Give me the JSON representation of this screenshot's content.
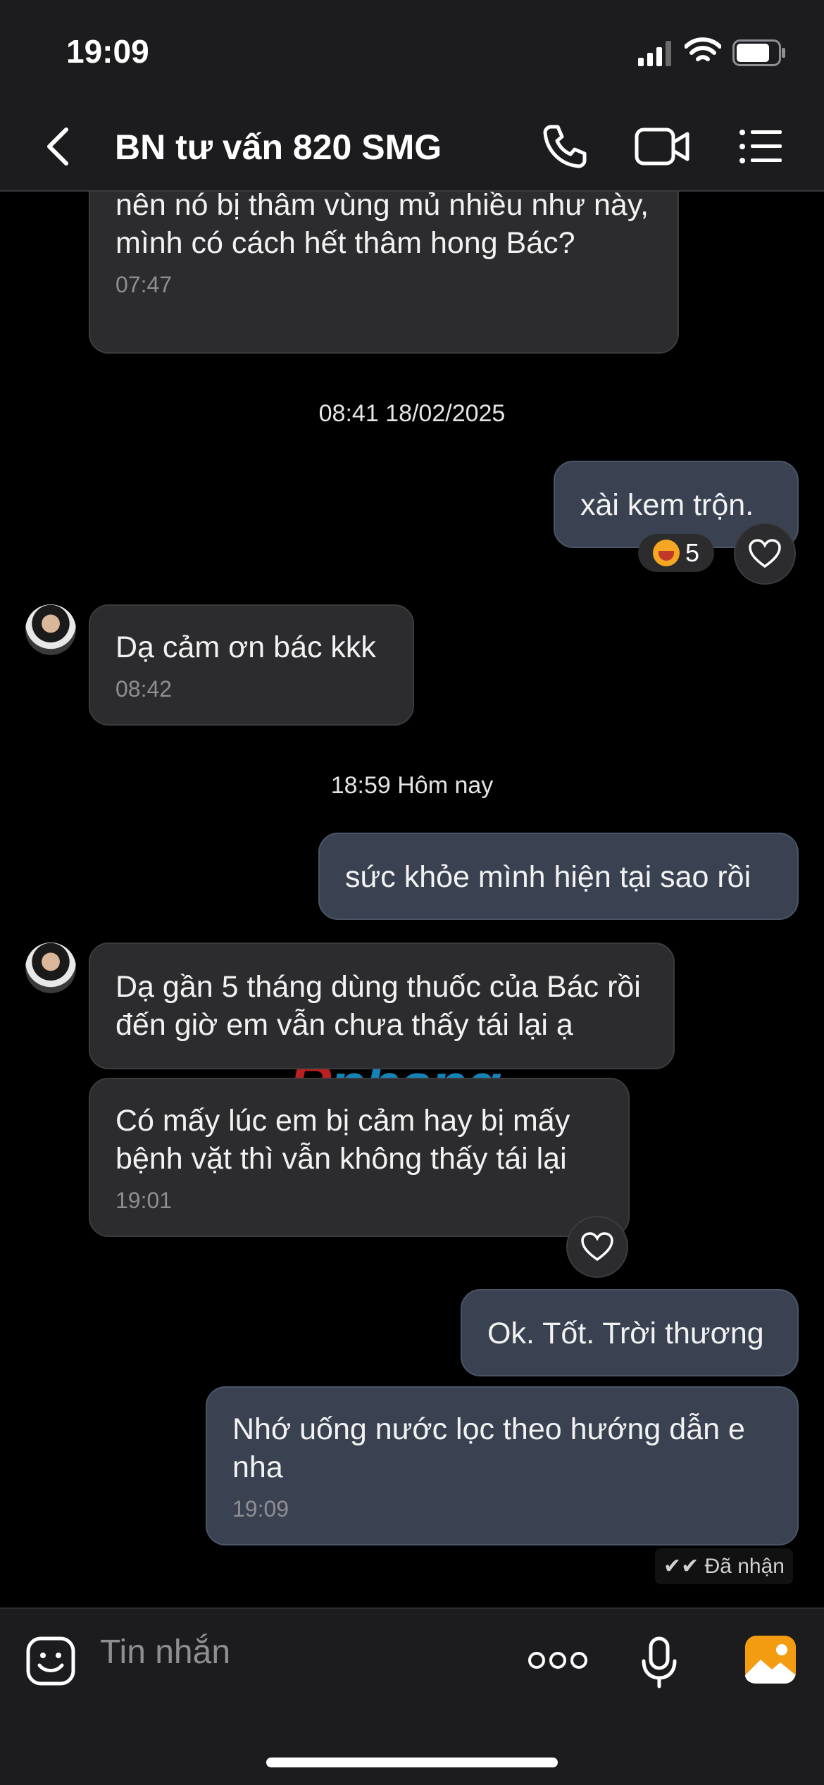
{
  "status_bar": {
    "time": "19:09"
  },
  "header": {
    "title": "BN tư vấn 820 SMG"
  },
  "messages": [
    {
      "text": "nên nó bị thâm vùng mủ nhiều như này, mình có cách hết thâm hong Bác?",
      "time": "07:47"
    },
    {
      "text": "xài  kem trộn."
    },
    {
      "text": "Dạ cảm ơn bác kkk",
      "time": "08:42"
    },
    {
      "text": "sức khỏe mình hiện tại sao rồi"
    },
    {
      "text": "Dạ gần 5 tháng  dùng thuốc của Bác rồi đến giờ em vẫn chưa thấy tái lại ạ"
    },
    {
      "text": "Có mấy lúc em bị cảm hay bị mấy bệnh vặt thì vẫn không thấy tái lại",
      "time": "19:01"
    },
    {
      "text": "Ok. Tốt. Trời thương"
    },
    {
      "text": "Nhớ uống nước lọc theo hướng dẫn e nha",
      "time": "19:09"
    }
  ],
  "separators": {
    "first": "08:41 18/02/2025",
    "second": "18:59 Hôm nay"
  },
  "reaction": {
    "count": "5"
  },
  "receipt": "Đã nhận",
  "input": {
    "placeholder": "Tin nhắn"
  },
  "watermark": {
    "part1": "R",
    "part2": "phang"
  },
  "colors": {
    "incoming": "#2c2c2e",
    "outgoing": "#3a4252",
    "accent": "#f39c12"
  }
}
